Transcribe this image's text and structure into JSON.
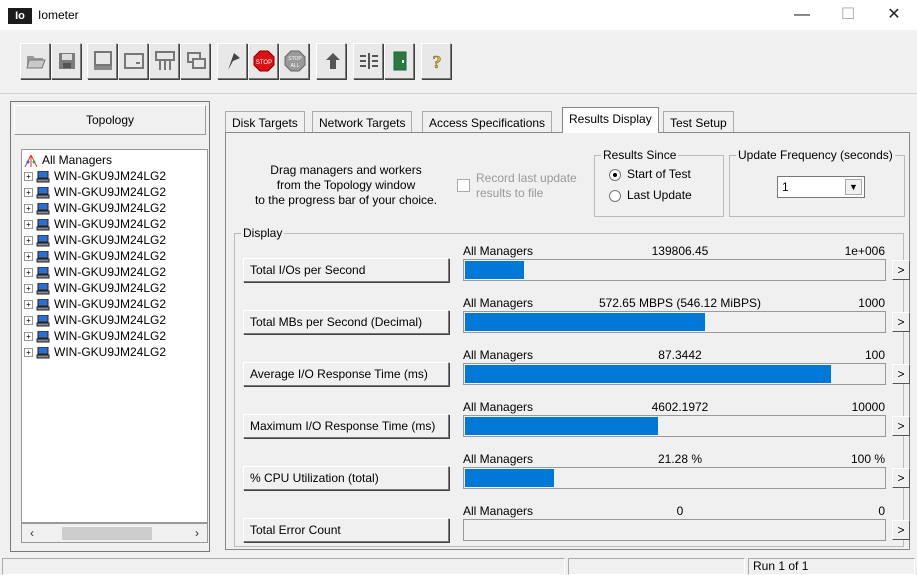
{
  "window": {
    "title": "Iometer",
    "app_icon_text": "Io",
    "minimize": "—",
    "maximize": "☐",
    "close": "✕"
  },
  "toolbar": {
    "buttons": [
      "open-config-icon",
      "save-config-icon",
      "new-manager-icon",
      "new-disk-worker-icon",
      "new-network-worker-icon",
      "duplicate-worker-icon",
      "start-tests-icon",
      "stop-icon",
      "stop-all-icon",
      "reset-workers-icon",
      "disconnect-icon",
      "exit-icon",
      "about-icon"
    ]
  },
  "topology": {
    "header": "Topology",
    "root": "All Managers",
    "managers": [
      "WIN-GKU9JM24LG2",
      "WIN-GKU9JM24LG2",
      "WIN-GKU9JM24LG2",
      "WIN-GKU9JM24LG2",
      "WIN-GKU9JM24LG2",
      "WIN-GKU9JM24LG2",
      "WIN-GKU9JM24LG2",
      "WIN-GKU9JM24LG2",
      "WIN-GKU9JM24LG2",
      "WIN-GKU9JM24LG2",
      "WIN-GKU9JM24LG2",
      "WIN-GKU9JM24LG2"
    ]
  },
  "tabs": [
    "Disk Targets",
    "Network Targets",
    "Access Specifications",
    "Results Display",
    "Test Setup"
  ],
  "active_tab": "Results Display",
  "results": {
    "drag_text": [
      "Drag managers and workers",
      "from the Topology window",
      "to the progress bar of your choice."
    ],
    "record_text": [
      "Record last update",
      "results to file"
    ],
    "results_since_label": "Results Since",
    "start_of_test": "Start of Test",
    "last_update": "Last Update",
    "update_freq_label": "Update Frequency (seconds)",
    "update_freq_value": "1",
    "display_label": "Display",
    "metrics": [
      {
        "button": "Total I/Os per Second",
        "source": "All Managers",
        "value": "139806.45",
        "max": "1e+006",
        "fill": 0.1398
      },
      {
        "button": "Total MBs per Second (Decimal)",
        "source": "All Managers",
        "value": "572.65 MBPS (546.12 MiBPS)",
        "max": "1000",
        "fill": 0.5727
      },
      {
        "button": "Average I/O Response Time (ms)",
        "source": "All Managers",
        "value": "87.3442",
        "max": "100",
        "fill": 0.8734
      },
      {
        "button": "Maximum I/O Response Time (ms)",
        "source": "All Managers",
        "value": "4602.1972",
        "max": "10000",
        "fill": 0.4602
      },
      {
        "button": "% CPU Utilization (total)",
        "source": "All Managers",
        "value": "21.28 %",
        "max": "100 %",
        "fill": 0.2128
      },
      {
        "button": "Total Error Count",
        "source": "All Managers",
        "value": "0",
        "max": "0",
        "fill": 0
      }
    ],
    "more_button": ">"
  },
  "status": {
    "run": "Run 1 of 1"
  },
  "colors": {
    "bar": "#0078d7"
  }
}
